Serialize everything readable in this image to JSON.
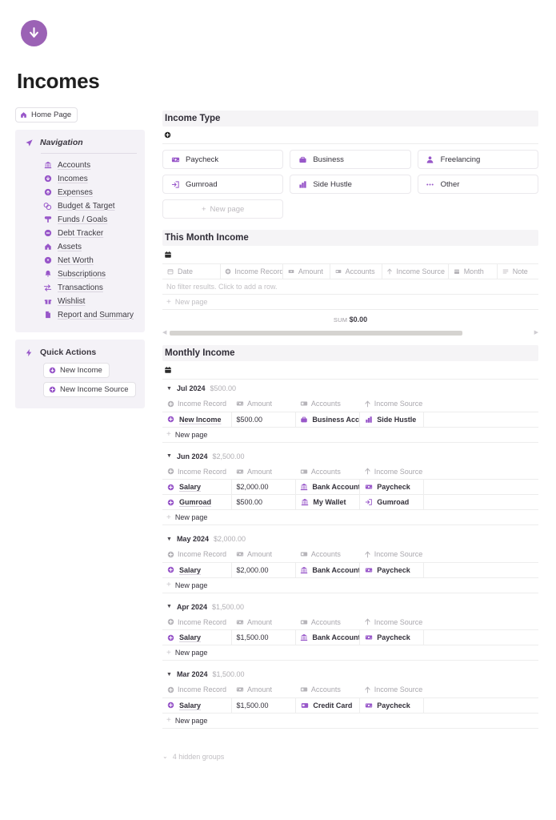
{
  "page": {
    "icon": "down-arrow-circle-icon",
    "title": "Incomes",
    "accent_color": "#9857c9",
    "sidebar_bg": "#f4f2f7",
    "section_header_bg": "#f5f4f6"
  },
  "sidebar": {
    "home_button": {
      "label": "Home Page",
      "icon": "home-icon"
    },
    "navigation": {
      "title": "Navigation",
      "icon": "paper-plane-icon",
      "items": [
        {
          "label": "Accounts",
          "icon": "bank-icon"
        },
        {
          "label": "Incomes",
          "icon": "down-arrow-circle-icon"
        },
        {
          "label": "Expenses",
          "icon": "up-arrow-circle-icon"
        },
        {
          "label": "Budget & Target",
          "icon": "coins-icon"
        },
        {
          "label": "Funds / Goals",
          "icon": "tree-icon"
        },
        {
          "label": "Debt Tracker",
          "icon": "minus-circle-icon"
        },
        {
          "label": "Assets",
          "icon": "house-icon"
        },
        {
          "label": "Net Worth",
          "icon": "gear-circle-icon"
        },
        {
          "label": "Subscriptions",
          "icon": "bell-icon"
        },
        {
          "label": "Transactions",
          "icon": "transfer-arrows-icon"
        },
        {
          "label": "Wishlist",
          "icon": "gift-icon"
        },
        {
          "label": "Report and Summary",
          "icon": "document-icon"
        }
      ]
    },
    "quick_actions": {
      "title": "Quick Actions",
      "icon": "lightning-bolt-icon",
      "buttons": [
        {
          "label": "New Income",
          "icon": "down-arrow-circle-icon"
        },
        {
          "label": "New Income Source",
          "icon": "plus-circle-icon"
        }
      ]
    }
  },
  "income_type": {
    "heading": "Income Type",
    "toolbar_icon": "plus-circle-icon",
    "cards": [
      {
        "label": "Paycheck",
        "icon": "money-bill-icon"
      },
      {
        "label": "Business",
        "icon": "briefcase-icon"
      },
      {
        "label": "Freelancing",
        "icon": "person-icon"
      },
      {
        "label": "Gumroad",
        "icon": "login-arrow-icon"
      },
      {
        "label": "Side Hustle",
        "icon": "bar-chart-icon"
      },
      {
        "label": "Other",
        "icon": "ellipsis-icon"
      }
    ],
    "new_page_label": "New page",
    "new_page_icon": "plus-icon"
  },
  "this_month_income": {
    "heading": "This Month Income",
    "toolbar_icon": "calendar-icon",
    "columns": [
      {
        "label": "Date",
        "icon": "calendar-outline-icon"
      },
      {
        "label": "Income Record",
        "icon": "plus-circle-icon"
      },
      {
        "label": "Amount",
        "icon": "money-bill-icon"
      },
      {
        "label": "Accounts",
        "icon": "cards-icon"
      },
      {
        "label": "Income Source",
        "icon": "up-arrow-icon"
      },
      {
        "label": "Month",
        "icon": "calendar-icon"
      },
      {
        "label": "Note",
        "icon": "lines-icon"
      }
    ],
    "empty_message": "No filter results. Click to add a row.",
    "new_page_label": "New page",
    "sum_label": "SUM",
    "sum_value": "$0.00",
    "scrollbar": {
      "left_arrow": "chevron-left-icon",
      "right_arrow": "chevron-right-icon",
      "thumb_percent": 81
    }
  },
  "monthly_income": {
    "heading": "Monthly Income",
    "toolbar_icon": "calendar-icon",
    "group_columns": [
      {
        "label": "Income Record",
        "icon": "plus-circle-icon"
      },
      {
        "label": "Amount",
        "icon": "money-bill-icon"
      },
      {
        "label": "Accounts",
        "icon": "cards-icon"
      },
      {
        "label": "Income Source",
        "icon": "up-arrow-icon"
      }
    ],
    "new_page_label": "New page",
    "groups": [
      {
        "name": "Jul 2024",
        "total": "$500.00",
        "rows": [
          {
            "record": "New Income",
            "record_icon": "plus-circle-icon",
            "amount": "$500.00",
            "account": "Business Account",
            "account_icon": "briefcase-icon",
            "source": "Side Hustle",
            "source_icon": "bar-chart-icon"
          }
        ]
      },
      {
        "name": "Jun 2024",
        "total": "$2,500.00",
        "rows": [
          {
            "record": "Salary",
            "record_icon": "plus-circle-icon",
            "amount": "$2,000.00",
            "account": "Bank Account",
            "account_icon": "bank-icon",
            "source": "Paycheck",
            "source_icon": "money-bill-icon"
          },
          {
            "record": "Gumroad",
            "record_icon": "plus-circle-icon",
            "amount": "$500.00",
            "account": "My Wallet",
            "account_icon": "bank-icon",
            "source": "Gumroad",
            "source_icon": "login-arrow-icon"
          }
        ]
      },
      {
        "name": "May 2024",
        "total": "$2,000.00",
        "rows": [
          {
            "record": "Salary",
            "record_icon": "plus-circle-icon",
            "amount": "$2,000.00",
            "account": "Bank Account",
            "account_icon": "bank-icon",
            "source": "Paycheck",
            "source_icon": "money-bill-icon"
          }
        ]
      },
      {
        "name": "Apr 2024",
        "total": "$1,500.00",
        "rows": [
          {
            "record": "Salary",
            "record_icon": "plus-circle-icon",
            "amount": "$1,500.00",
            "account": "Bank Account",
            "account_icon": "bank-icon",
            "source": "Paycheck",
            "source_icon": "money-bill-icon"
          }
        ]
      },
      {
        "name": "Mar 2024",
        "total": "$1,500.00",
        "rows": [
          {
            "record": "Salary",
            "record_icon": "plus-circle-icon",
            "amount": "$1,500.00",
            "account": "Credit Card",
            "account_icon": "credit-card-icon",
            "source": "Paycheck",
            "source_icon": "money-bill-icon"
          }
        ]
      }
    ],
    "hidden_groups_label": "4 hidden groups",
    "hidden_groups_icon": "chevron-down-icon"
  }
}
